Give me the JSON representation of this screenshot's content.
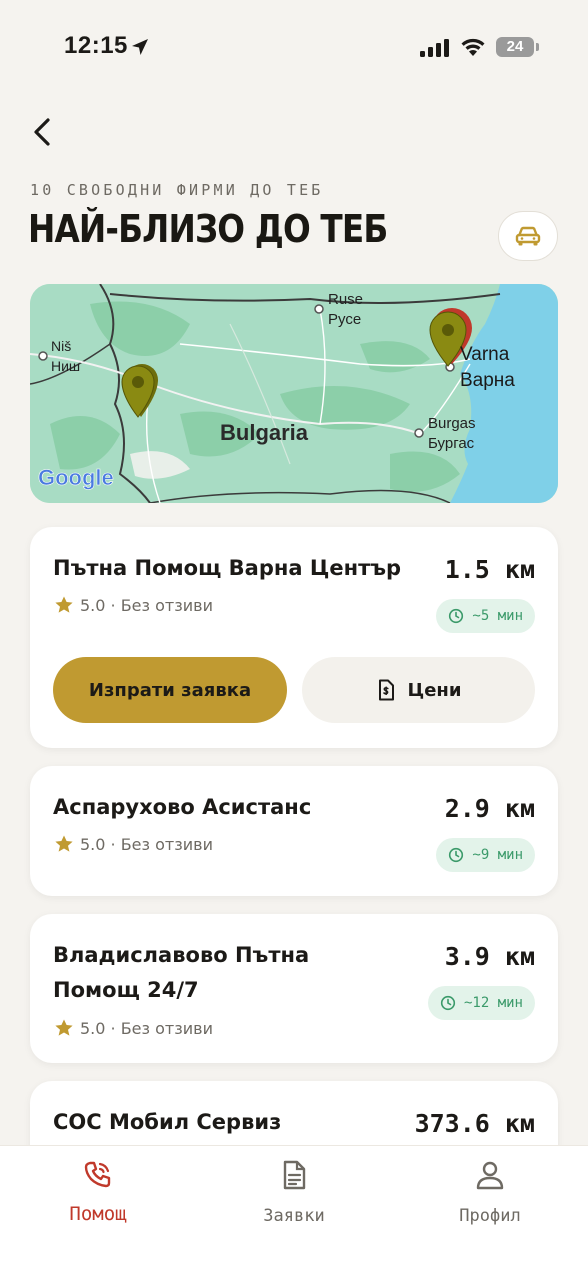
{
  "status_bar": {
    "time": "12:15",
    "battery": "24"
  },
  "header": {
    "subtitle": "10 СВОБОДНИ ФИРМИ ДО ТЕБ",
    "title": "НАЙ-БЛИЗО ДО ТЕБ"
  },
  "map": {
    "country_label": "Bulgaria",
    "cities": [
      {
        "latin": "Niš",
        "cyrillic": "Ниш"
      },
      {
        "latin": "Ruse",
        "cyrillic": "Русе"
      },
      {
        "latin": "Varna",
        "cyrillic": "Варна"
      },
      {
        "latin": "Burgas",
        "cyrillic": "Бургас"
      }
    ],
    "logo_text": "Google",
    "colors": {
      "land": "#a8dcc4",
      "sea": "#7fd0e8",
      "pin": "#8a8a12"
    }
  },
  "companies": [
    {
      "name": "Пътна Помощ Варна Център",
      "rating": "5.0 · Без отзиви",
      "distance": "1.5 км",
      "eta": "~5 мин"
    },
    {
      "name": "Аспарухово Асистанс",
      "rating": "5.0 · Без отзиви",
      "distance": "2.9 км",
      "eta": "~9 мин"
    },
    {
      "name": "Владиславово Пътна Помощ 24/7",
      "rating": "5.0 · Без отзиви",
      "distance": "3.9 км",
      "eta": "~12 мин"
    },
    {
      "name": "СОС Мобил Сервиз",
      "distance": "373.6 км"
    }
  ],
  "actions": {
    "send_request": "Изпрати заявка",
    "prices": "Цени"
  },
  "tabs": [
    {
      "label": "Помощ",
      "icon": "phone-icon",
      "active": true
    },
    {
      "label": "Заявки",
      "icon": "document-icon",
      "active": false
    },
    {
      "label": "Профил",
      "icon": "user-icon",
      "active": false
    }
  ],
  "colors": {
    "accent": "#c09a31",
    "active_tab": "#c0392b",
    "eta_bg": "#e3f3ea",
    "eta_text": "#3b9a6a"
  }
}
